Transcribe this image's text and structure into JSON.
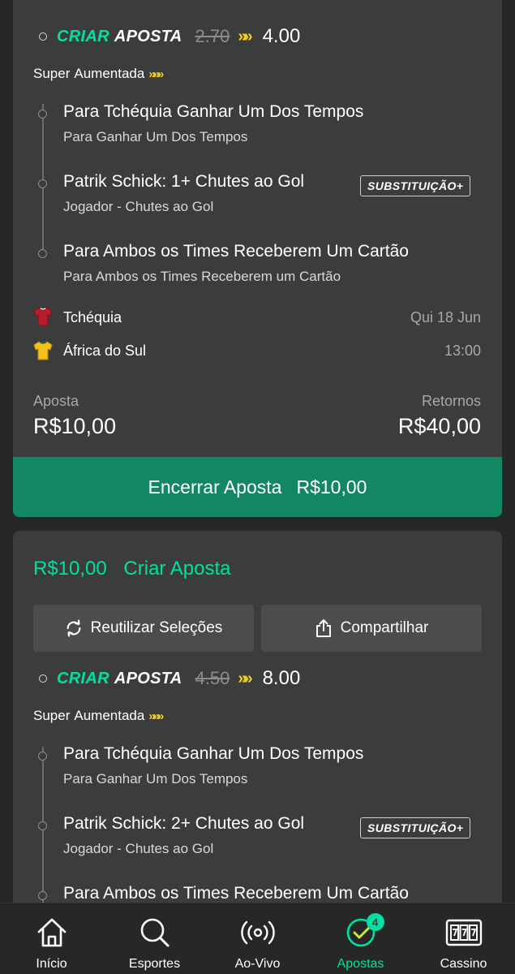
{
  "bets": [
    {
      "bet_builder": {
        "criar": "CRIAR",
        "aposta": "APOSTA",
        "old_odds": "2.70",
        "new_odds": "4.00"
      },
      "boost": {
        "word1": "Super",
        "word2": "Aumentada"
      },
      "selections": [
        {
          "title": "Para Tchéquia Ganhar Um Dos Tempos",
          "market": "Para Ganhar Um Dos Tempos",
          "badge": ""
        },
        {
          "title": "Patrik Schick: 1+ Chutes ao Gol",
          "market": "Jogador - Chutes ao Gol",
          "badge": "SUBSTITUIÇÃO+"
        },
        {
          "title": "Para Ambos os Times Receberem Um Cartão",
          "market": "Para Ambos os Times Receberem um Cartão",
          "badge": ""
        }
      ],
      "event": {
        "home_team": "Tchéquia",
        "away_team": "África do Sul",
        "date": "Qui 18 Jun",
        "time": "13:00",
        "home_shirt_color": "#b81c2c",
        "away_shirt_color": "#f2c21a"
      },
      "stake_label": "Aposta",
      "stake": "R$10,00",
      "returns_label": "Retornos",
      "returns": "R$40,00",
      "cashout": {
        "label": "Encerrar Aposta",
        "amount": "R$10,00"
      }
    },
    {
      "stake": "R$10,00",
      "type": "Criar Aposta",
      "actions": {
        "reuse": "Reutilizar Seleções",
        "share": "Compartilhar"
      },
      "bet_builder": {
        "criar": "CRIAR",
        "aposta": "APOSTA",
        "old_odds": "4.50",
        "new_odds": "8.00"
      },
      "boost": {
        "word1": "Super",
        "word2": "Aumentada"
      },
      "selections": [
        {
          "title": "Para Tchéquia Ganhar Um Dos Tempos",
          "market": "Para Ganhar Um Dos Tempos",
          "badge": ""
        },
        {
          "title": "Patrik Schick: 2+ Chutes ao Gol",
          "market": "Jogador - Chutes ao Gol",
          "badge": "SUBSTITUIÇÃO+"
        },
        {
          "title": "Para Ambos os Times Receberem Um Cartão",
          "market": "",
          "badge": ""
        }
      ]
    }
  ],
  "nav": [
    {
      "label": "Início",
      "icon": "home-icon"
    },
    {
      "label": "Esportes",
      "icon": "search-icon"
    },
    {
      "label": "Ao-Vivo",
      "icon": "live-broadcast-icon"
    },
    {
      "label": "Apostas",
      "icon": "bets-check-icon",
      "badge": "4",
      "active": true
    },
    {
      "label": "Cassino",
      "icon": "slot-machine-icon"
    }
  ],
  "colors": {
    "background": "#252826",
    "card": "#3a3d3b",
    "accent_green": "#00e0a0",
    "cashout_green": "#138764",
    "boost_yellow": "#f6d21e"
  }
}
